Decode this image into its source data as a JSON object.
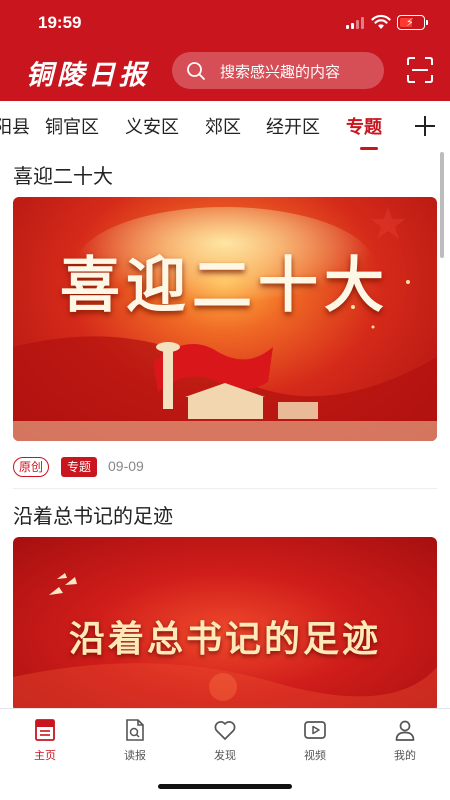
{
  "status_bar": {
    "time": "19:59"
  },
  "header": {
    "logo_text": "铜陵日报",
    "search_placeholder": "搜索感兴趣的内容"
  },
  "tabs": [
    {
      "label": "阳县",
      "active": false
    },
    {
      "label": "铜官区",
      "active": false
    },
    {
      "label": "义安区",
      "active": false
    },
    {
      "label": "郊区",
      "active": false
    },
    {
      "label": "经开区",
      "active": false
    },
    {
      "label": "专题",
      "active": true
    }
  ],
  "articles": [
    {
      "title": "喜迎二十大",
      "banner_text": "喜迎二十大",
      "tag_original": "原创",
      "tag_category": "专题",
      "date": "09-09"
    },
    {
      "title": "沿着总书记的足迹",
      "banner_text": "沿着总书记的足迹"
    }
  ],
  "bottom_nav": [
    {
      "label": "主页",
      "icon": "news-icon",
      "active": true
    },
    {
      "label": "读报",
      "icon": "newspaper-icon",
      "active": false
    },
    {
      "label": "发现",
      "icon": "heart-icon",
      "active": false
    },
    {
      "label": "视频",
      "icon": "video-icon",
      "active": false
    },
    {
      "label": "我的",
      "icon": "user-icon",
      "active": false
    }
  ],
  "colors": {
    "brand": "#c8151e",
    "muted": "#888888"
  }
}
